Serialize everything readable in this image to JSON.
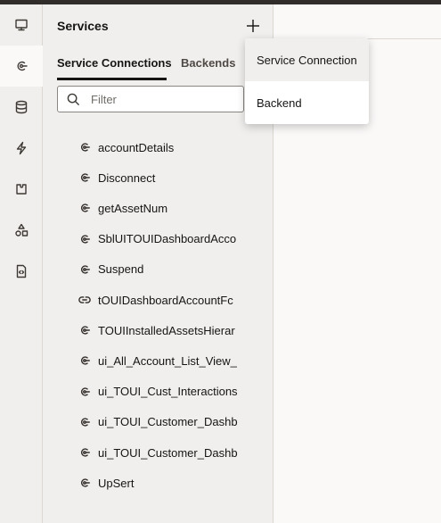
{
  "panel": {
    "title": "Services",
    "add_label": "+"
  },
  "tabs": [
    {
      "label": "Service Connections",
      "selected": true
    },
    {
      "label": "Backends",
      "selected": false
    }
  ],
  "filter": {
    "placeholder": "Filter",
    "value": ""
  },
  "services": [
    {
      "label": "accountDetails",
      "icon": "service-connection-icon"
    },
    {
      "label": "Disconnect",
      "icon": "service-connection-icon"
    },
    {
      "label": "getAssetNum",
      "icon": "service-connection-icon"
    },
    {
      "label": "SblUITOUIDashboardAcco",
      "icon": "service-connection-icon"
    },
    {
      "label": "Suspend",
      "icon": "service-connection-icon"
    },
    {
      "label": "tOUIDashboardAccountFc",
      "icon": "link-icon"
    },
    {
      "label": "TOUIInstalledAssetsHierar",
      "icon": "service-connection-icon"
    },
    {
      "label": "ui_All_Account_List_View_",
      "icon": "service-connection-icon"
    },
    {
      "label": "ui_TOUI_Cust_Interactions",
      "icon": "service-connection-icon"
    },
    {
      "label": "ui_TOUI_Customer_Dashb",
      "icon": "service-connection-icon"
    },
    {
      "label": "ui_TOUI_Customer_Dashb",
      "icon": "service-connection-icon"
    },
    {
      "label": "UpSert",
      "icon": "service-connection-icon"
    }
  ],
  "menu": {
    "items": [
      {
        "label": "Service Connection"
      },
      {
        "label": "Backend"
      }
    ]
  },
  "rail": {
    "items": [
      {
        "icon": "monitor-icon"
      },
      {
        "icon": "service-connection-icon"
      },
      {
        "icon": "database-icon"
      },
      {
        "icon": "lightning-icon"
      },
      {
        "icon": "extension-icon"
      },
      {
        "icon": "components-icon"
      },
      {
        "icon": "source-file-icon"
      }
    ]
  }
}
